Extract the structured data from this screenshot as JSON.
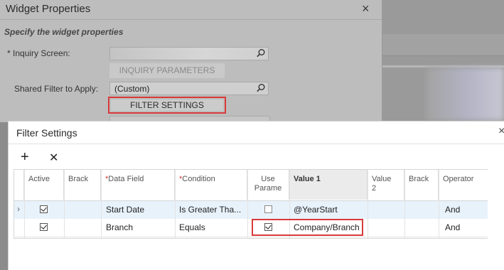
{
  "widget_properties": {
    "title": "Widget Properties",
    "subtitle": "Specify the widget properties",
    "inquiry_screen_label": "Inquiry Screen:",
    "inquiry_screen_required": "*",
    "inquiry_screen_value": "",
    "inquiry_parameters_button": "INQUIRY PARAMETERS",
    "shared_filter_label": "Shared Filter to Apply:",
    "shared_filter_value": "(Custom)",
    "filter_settings_button": "FILTER SETTINGS",
    "close_icon": "×"
  },
  "filter_settings": {
    "title": "Filter Settings",
    "close_icon": "×",
    "toolbar": {
      "add_icon": "+",
      "delete_icon": "✕"
    },
    "columns": [
      {
        "label": "Active",
        "required": false
      },
      {
        "label": "Brack",
        "required": false
      },
      {
        "label": "Data Field",
        "required": true
      },
      {
        "label": "Condition",
        "required": true
      },
      {
        "label": "Use Parame",
        "required": false
      },
      {
        "label": "Value 1",
        "required": false
      },
      {
        "label": "Value 2",
        "required": false
      },
      {
        "label": "Brack",
        "required": false
      },
      {
        "label": "Operator",
        "required": false
      }
    ],
    "rows": [
      {
        "selected": true,
        "active": true,
        "open_bracket": "",
        "data_field": "Start Date",
        "condition": "Is Greater Tha...",
        "use_parameter": false,
        "value1": "@YearStart",
        "value2": "",
        "close_bracket": "",
        "operator": "And"
      },
      {
        "selected": false,
        "active": true,
        "open_bracket": "",
        "data_field": "Branch",
        "condition": "Equals",
        "use_parameter": true,
        "value1": "Company/Branch",
        "value2": "",
        "close_bracket": "",
        "operator": "And"
      }
    ],
    "row_indicator": "›",
    "required_marker": "*"
  },
  "colors": {
    "highlight": "#d93a3a",
    "selected_row": "#e8f2fb",
    "overlay": "#bdbdbd"
  }
}
